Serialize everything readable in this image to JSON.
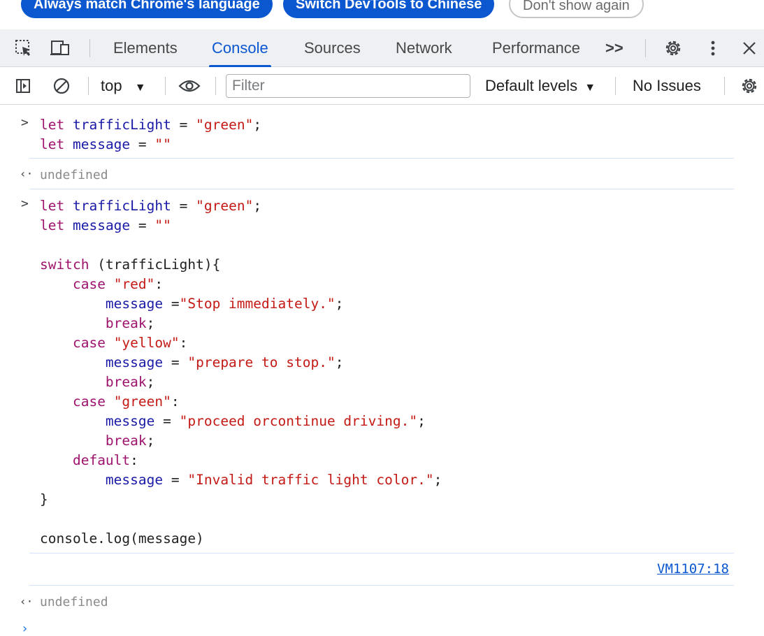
{
  "banner": {
    "buttons": [
      "Always match Chrome's language",
      "Switch DevTools to Chinese",
      "Don't show again"
    ]
  },
  "tabs": {
    "items": [
      "Elements",
      "Console",
      "Sources",
      "Network",
      "Performance"
    ],
    "active": "Console",
    "more": ">>"
  },
  "toolbar": {
    "context": "top",
    "filter_placeholder": "Filter",
    "levels": "Default levels",
    "issues": "No Issues"
  },
  "console": {
    "entry1": [
      "let trafficLight = \"green\";",
      "let message = \"\""
    ],
    "result1": "undefined",
    "entry2": [
      "let trafficLight = \"green\";",
      "let message = \"\"",
      "",
      "switch (trafficLight){",
      "    case \"red\":",
      "        message =\"Stop immediately.\";",
      "        break;",
      "    case \"yellow\":",
      "        message = \"prepare to stop.\";",
      "        break;",
      "    case \"green\":",
      "        messge = \"proceed orcontinue driving.\";",
      "        break;",
      "    default:",
      "        message = \"Invalid traffic light color.\";",
      "}",
      "",
      "console.log(message)"
    ],
    "log_source": "VM1107:18",
    "result2": "undefined"
  },
  "colors": {
    "accent": "#0b57d0",
    "keyword": "#9e136c",
    "variable": "#1a1aa6",
    "string": "#c41a16"
  }
}
